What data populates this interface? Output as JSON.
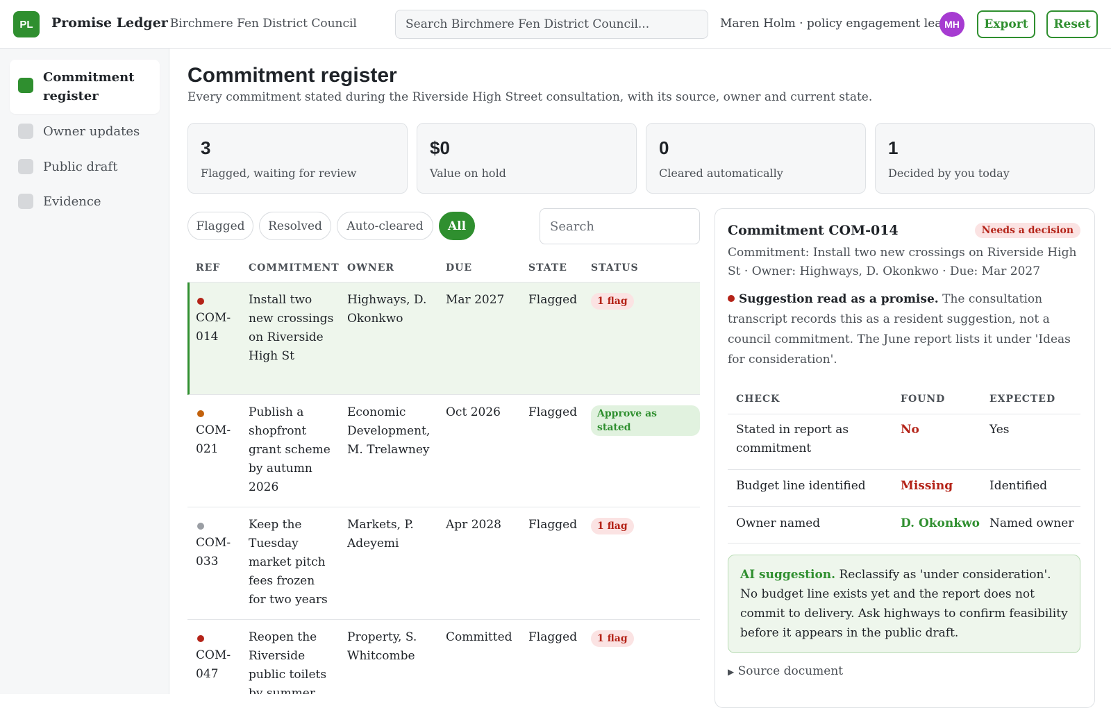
{
  "header": {
    "logo_text": "PL",
    "app_name": "Promise Ledger",
    "org_name": "· Birchmere Fen District Council",
    "search_placeholder": "Search Birchmere Fen District Council...",
    "user": "Maren Holm · policy engagement lead",
    "avatar_initials": "MH",
    "export_label": "Export",
    "reset_label": "Reset"
  },
  "sidebar": {
    "items": [
      {
        "label": "Commitment register",
        "active": true
      },
      {
        "label": "Owner updates",
        "active": false
      },
      {
        "label": "Public draft",
        "active": false
      },
      {
        "label": "Evidence",
        "active": false
      }
    ]
  },
  "main": {
    "title": "Commitment register",
    "subtitle": "Every commitment stated during the Riverside High Street consultation, with its source, owner and current state.",
    "stats": [
      {
        "value": "3",
        "label": "Flagged, waiting for review"
      },
      {
        "value": "$0",
        "label": "Value on hold"
      },
      {
        "value": "0",
        "label": "Cleared automatically"
      },
      {
        "value": "1",
        "label": "Decided by you today"
      }
    ],
    "filters": [
      "Flagged",
      "Resolved",
      "Auto-cleared",
      "All"
    ],
    "active_filter": "All",
    "table_search_placeholder": "Search",
    "columns": [
      "REF",
      "COMMITMENT",
      "OWNER",
      "DUE",
      "STATE",
      "STATUS"
    ],
    "rows": [
      {
        "ref": "COM-014",
        "dot_color": "#b42318",
        "commitment": "Install two new crossings on Riverside High St",
        "owner": "Highways, D. Okonkwo",
        "due": "Mar 2027",
        "state": "Flagged",
        "status": "1 flag",
        "status_type": "red",
        "selected": true
      },
      {
        "ref": "COM-021",
        "dot_color": "#c2610c",
        "commitment": "Publish a shopfront grant scheme by autumn 2026",
        "owner": "Economic Development, M. Trelawney",
        "due": "Oct 2026",
        "state": "Flagged",
        "status": "Approve as stated",
        "status_type": "green",
        "selected": false
      },
      {
        "ref": "COM-033",
        "dot_color": "#9a9ea4",
        "commitment": "Keep the Tuesday market pitch fees frozen for two years",
        "owner": "Markets, P. Adeyemi",
        "due": "Apr 2028",
        "state": "Flagged",
        "status": "1 flag",
        "status_type": "red",
        "selected": false
      },
      {
        "ref": "COM-047",
        "dot_color": "#b42318",
        "commitment": "Reopen the Riverside public toilets by summer",
        "owner": "Property, S. Whitcombe",
        "due": "Committed",
        "state": "Flagged",
        "status": "1 flag",
        "status_type": "red",
        "selected": false
      }
    ]
  },
  "detail": {
    "title": "Commitment COM-014",
    "badge": "Needs a decision",
    "description": "Commitment: Install two new crossings on Riverside High St · Owner: Highways, D. Okonkwo · Due: Mar 2027",
    "finding_title": "Suggestion read as a promise.",
    "finding_text": "The consultation transcript records this as a resident suggestion, not a council commitment. The June report lists it under 'Ideas for consideration'.",
    "check_columns": [
      "CHECK",
      "FOUND",
      "EXPECTED"
    ],
    "checks": [
      {
        "check": "Stated in report as commitment",
        "found": "No",
        "found_type": "red",
        "expected": "Yes"
      },
      {
        "check": "Budget line identified",
        "found": "Missing",
        "found_type": "red",
        "expected": "Identified"
      },
      {
        "check": "Owner named",
        "found": "D. Okonkwo",
        "found_type": "green",
        "expected": "Named owner"
      }
    ],
    "ai_label": "AI suggestion.",
    "ai_text": "Reclassify as 'under consideration'. No budget line exists yet and the report does not commit to delivery. Ask highways to confirm feasibility before it appears in the public draft.",
    "source_label": "Source document"
  }
}
